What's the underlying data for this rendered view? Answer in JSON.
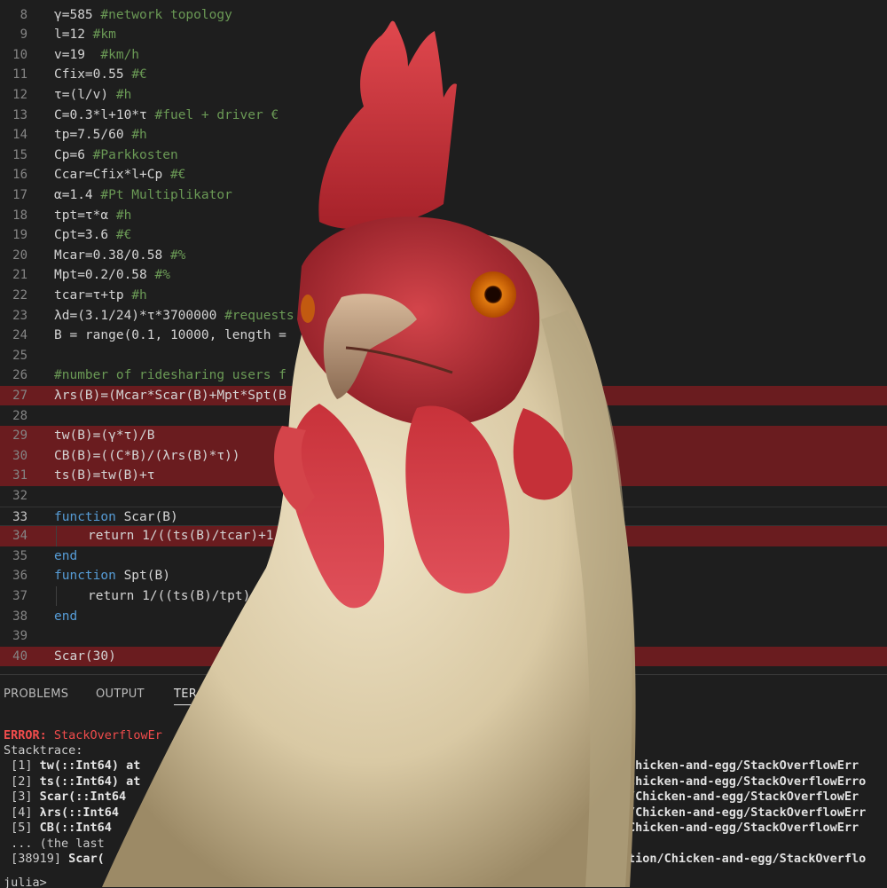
{
  "editor": {
    "lines": [
      {
        "n": "8",
        "code": "γ=585 ",
        "comment": "#network topology"
      },
      {
        "n": "9",
        "code": "l=12 ",
        "comment": "#km"
      },
      {
        "n": "10",
        "code": "v=19  ",
        "comment": "#km/h"
      },
      {
        "n": "11",
        "code": "Cfix=0.55 ",
        "comment": "#€"
      },
      {
        "n": "12",
        "code": "τ=(l/v) ",
        "comment": "#h"
      },
      {
        "n": "13",
        "code": "C=0.3*l+10*τ ",
        "comment": "#fuel + driver €"
      },
      {
        "n": "14",
        "code": "tp=7.5/60 ",
        "comment": "#h"
      },
      {
        "n": "15",
        "code": "Cp=6 ",
        "comment": "#Parkkosten"
      },
      {
        "n": "16",
        "code": "Ccar=Cfix*l+Cp ",
        "comment": "#€"
      },
      {
        "n": "17",
        "code": "α=1.4 ",
        "comment": "#Pt Multiplikator"
      },
      {
        "n": "18",
        "code": "tpt=τ*α ",
        "comment": "#h"
      },
      {
        "n": "19",
        "code": "Cpt=3.6 ",
        "comment": "#€"
      },
      {
        "n": "20",
        "code": "Mcar=0.38/0.58 ",
        "comment": "#%"
      },
      {
        "n": "21",
        "code": "Mpt=0.2/0.58 ",
        "comment": "#%"
      },
      {
        "n": "22",
        "code": "tcar=τ+tp ",
        "comment": "#h"
      },
      {
        "n": "23",
        "code": "λd=(3.1/24)*τ*3700000 ",
        "comment": "#requests"
      },
      {
        "n": "24",
        "code": "B = range(0.1, 10000, length = ",
        "comment": ""
      },
      {
        "n": "25",
        "code": "",
        "comment": ""
      },
      {
        "n": "26",
        "code": "",
        "comment": "#number of ridesharing users f"
      },
      {
        "n": "27",
        "code": "λrs(B)=(Mcar*Scar(B)+Mpt*Spt(B",
        "comment": ""
      },
      {
        "n": "28",
        "code": "",
        "comment": ""
      },
      {
        "n": "29",
        "code": "tw(B)=(γ*τ)/B",
        "comment": ""
      },
      {
        "n": "30",
        "code": "CB(B)=((C*B)/(λrs(B)*τ))",
        "comment": ""
      },
      {
        "n": "31",
        "code": "ts(B)=tw(B)+τ",
        "comment": ""
      },
      {
        "n": "32",
        "code": "",
        "comment": ""
      },
      {
        "n": "33",
        "kw": "function",
        "code": " Scar(B)",
        "comment": ""
      },
      {
        "n": "34",
        "kw2": "return",
        "code": " 1/((ts(B)/tcar)+1",
        "comment": ""
      },
      {
        "n": "35",
        "kw": "end",
        "code": "",
        "comment": ""
      },
      {
        "n": "36",
        "kw": "function",
        "code": " Spt(B)",
        "comment": ""
      },
      {
        "n": "37",
        "kw2": "return",
        "code": " 1/((ts(B)/tpt)",
        "comment": ""
      },
      {
        "n": "38",
        "kw": "end",
        "code": "",
        "comment": ""
      },
      {
        "n": "39",
        "code": "",
        "comment": ""
      },
      {
        "n": "40",
        "code": "Scar(30)",
        "comment": ""
      }
    ]
  },
  "panel": {
    "tabs": [
      "PROBLEMS",
      "OUTPUT",
      "TER"
    ],
    "error_label": "ERROR:",
    "error_type": " StackOverflowEr",
    "stacktrace_label": "Stacktrace:",
    "frames": [
      {
        "idx": " [1]",
        "fn": " tw(::Int64) at",
        "path": "Chicken-and-egg/StackOverflowErr"
      },
      {
        "idx": " [2]",
        "fn": " ts(::Int64) at",
        "path": "Chicken-and-egg/StackOverflowErro"
      },
      {
        "idx": " [3]",
        "fn": " Scar(::Int64",
        "path": "/Chicken-and-egg/StackOverflowEr"
      },
      {
        "idx": " [4]",
        "fn": " λrs(::Int64",
        "path": "/Chicken-and-egg/StackOverflowErr"
      },
      {
        "idx": " [5]",
        "fn": " CB(::Int64",
        "path": "Chicken-and-egg/StackOverflowErr"
      }
    ],
    "ellipsis": " ... (the last",
    "last_frame_idx": " [38919]",
    "last_frame_fn": " Scar(",
    "last_frame_path": "tion/Chicken-and-egg/StackOverflo",
    "prompt": "julia> "
  },
  "colors": {
    "error_highlight": "#7a1c20",
    "keyword": "#569cd6",
    "comment": "#6a9955"
  },
  "overlay": {
    "subject": "chicken-photo"
  }
}
